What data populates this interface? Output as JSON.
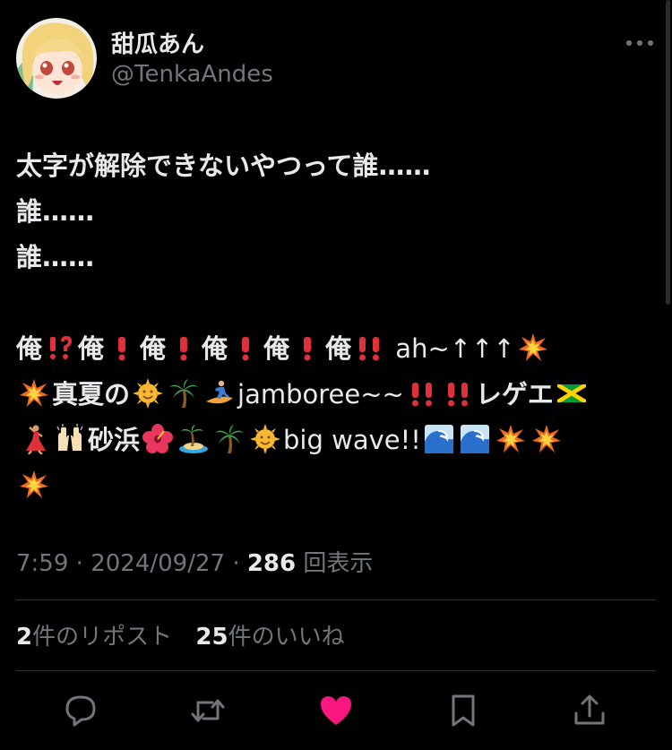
{
  "author": {
    "display_name": "甜瓜あん",
    "handle": "@TenkaAndes",
    "avatar_icon": "anime-girl-avatar"
  },
  "more_icon": "more-options-icon",
  "tweet": {
    "line1": "太字が解除できないやつって誰……",
    "line2": "誰……",
    "line3": "誰……",
    "line4_parts": [
      "俺",
      "⁉️",
      "俺",
      "❗",
      "俺",
      "❗",
      "俺",
      "❗",
      "俺",
      "❗",
      "俺",
      "‼️",
      " ah~↑↑↑"
    ],
    "line5_parts": [
      "真夏の",
      "jamboree~~",
      "レゲエ"
    ],
    "line6_parts": [
      "砂浜",
      "big wave!!"
    ]
  },
  "meta": {
    "time": "7:59",
    "date": "2024/09/27",
    "views": "286",
    "views_label": "回表示"
  },
  "stats": {
    "reposts": "2",
    "reposts_label": "件のリポスト",
    "likes": "25",
    "likes_label": "件のいいね"
  },
  "colors": {
    "background": "#000000",
    "text": "#e7e9ea",
    "secondary": "#71767b",
    "like_pink": "#f91880"
  },
  "actions": [
    "reply-icon",
    "retweet-icon",
    "like-icon-filled",
    "bookmark-icon",
    "share-icon"
  ]
}
